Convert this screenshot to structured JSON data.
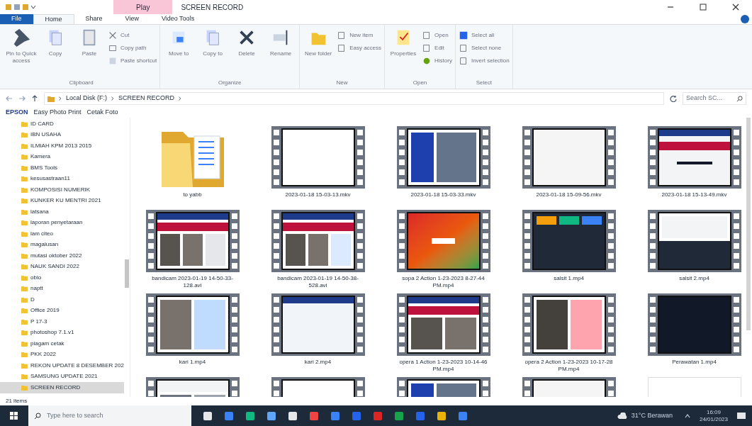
{
  "title_bar": {
    "contextual_tab": "Play",
    "title": "SCREEN RECORD"
  },
  "ribbon_tabs": [
    {
      "label": "File",
      "kind": "file",
      "selected": false
    },
    {
      "label": "Home",
      "kind": "tab",
      "selected": true
    },
    {
      "label": "Share",
      "kind": "tab",
      "selected": false
    },
    {
      "label": "View",
      "kind": "tab",
      "selected": false
    },
    {
      "label": "Video Tools",
      "kind": "tab",
      "selected": false
    }
  ],
  "ribbon_groups": [
    {
      "label": "Clipboard",
      "buttons": [
        {
          "label": "Pin to Quick access",
          "kind": "large"
        },
        {
          "label": "Copy",
          "kind": "large"
        },
        {
          "label": "Paste",
          "kind": "large"
        },
        {
          "label": "Cut",
          "kind": "small"
        },
        {
          "label": "Copy path",
          "kind": "small"
        },
        {
          "label": "Paste shortcut",
          "kind": "small"
        }
      ]
    },
    {
      "label": "Organize",
      "buttons": [
        {
          "label": "Move to",
          "kind": "large"
        },
        {
          "label": "Copy to",
          "kind": "large"
        },
        {
          "label": "Delete",
          "kind": "large"
        },
        {
          "label": "Rename",
          "kind": "large"
        }
      ]
    },
    {
      "label": "New",
      "buttons": [
        {
          "label": "New folder",
          "kind": "large"
        },
        {
          "label": "New item",
          "kind": "small"
        },
        {
          "label": "Easy access",
          "kind": "small"
        }
      ]
    },
    {
      "label": "Open",
      "buttons": [
        {
          "label": "Properties",
          "kind": "large"
        },
        {
          "label": "Open",
          "kind": "small"
        },
        {
          "label": "Edit",
          "kind": "small"
        },
        {
          "label": "History",
          "kind": "small"
        }
      ]
    },
    {
      "label": "Select",
      "buttons": [
        {
          "label": "Select all",
          "kind": "small"
        },
        {
          "label": "Select none",
          "kind": "small"
        },
        {
          "label": "Invert selection",
          "kind": "small"
        }
      ]
    }
  ],
  "address": {
    "path": [
      "Local Disk (F:)",
      "SCREEN RECORD"
    ],
    "search_placeholder": "Search SC..."
  },
  "toolbar": {
    "brand": "EPSON",
    "items": [
      "Easy Photo Print",
      "Cetak Foto"
    ]
  },
  "nav_items": [
    {
      "label": "ID CARD",
      "selected": false
    },
    {
      "label": "IBN USAHA",
      "selected": false
    },
    {
      "label": "ILMIAH KPM 2013 2015",
      "selected": false
    },
    {
      "label": "Kamera",
      "selected": false
    },
    {
      "label": "BMS Tools",
      "selected": false
    },
    {
      "label": "kesusastraan11",
      "selected": false
    },
    {
      "label": "KOMPOSISI NUMERIK",
      "selected": false
    },
    {
      "label": "KUNKER KU MENTRI 2021",
      "selected": false
    },
    {
      "label": "latsana",
      "selected": false
    },
    {
      "label": "laporan penyetaraan",
      "selected": false
    },
    {
      "label": "lam citeo",
      "selected": false
    },
    {
      "label": "magalusan",
      "selected": false
    },
    {
      "label": "mutasi oktober 2022",
      "selected": false
    },
    {
      "label": "NAUK SANDI 2022",
      "selected": false
    },
    {
      "label": "oblo",
      "selected": false
    },
    {
      "label": "naptt",
      "selected": false
    },
    {
      "label": "D",
      "selected": false
    },
    {
      "label": "Office 2019",
      "selected": false
    },
    {
      "label": "P 17-3",
      "selected": false
    },
    {
      "label": "photoshop 7.1.v1",
      "selected": false
    },
    {
      "label": "piagam cetak",
      "selected": false
    },
    {
      "label": "PKK 2022",
      "selected": false
    },
    {
      "label": "REKON UPDATE 8 DESEMBER 202",
      "selected": false
    },
    {
      "label": "SAMSUNG UPDATE 2021",
      "selected": false
    },
    {
      "label": "SCREEN RECORD",
      "selected": true
    }
  ],
  "files": [
    {
      "name": "to yabb",
      "kind": "folder"
    },
    {
      "name": "2023-01-18 15-03-13.mkv",
      "kind": "video"
    },
    {
      "name": "2023-01-18 15-03-33.mkv",
      "kind": "video"
    },
    {
      "name": "2023-01-18 15-09-56.mkv",
      "kind": "video"
    },
    {
      "name": "2023-01-18 15-13-49.mkv",
      "kind": "video"
    },
    {
      "name": "bandicam 2023-01-19 14-50-33-128.avi",
      "kind": "video"
    },
    {
      "name": "bandicam 2023-01-19 14-50-38-528.avi",
      "kind": "video"
    },
    {
      "name": "sopa 2 Action 1-23-2023 8-27-44 PM.mp4",
      "kind": "video"
    },
    {
      "name": "salsit 1.mp4",
      "kind": "video"
    },
    {
      "name": "salsit 2.mp4",
      "kind": "video"
    },
    {
      "name": "kari 1.mp4",
      "kind": "video"
    },
    {
      "name": "kari 2.mp4",
      "kind": "video"
    },
    {
      "name": "opera 1 Action 1-23-2023 10-14-46 PM.mp4",
      "kind": "video"
    },
    {
      "name": "opera 2 Action 1-23-2023 10-17-28 PM.mp4",
      "kind": "video"
    },
    {
      "name": "Perawatan 1.mp4",
      "kind": "video"
    },
    {
      "kind": "video"
    },
    {
      "kind": "video"
    },
    {
      "kind": "video"
    },
    {
      "kind": "video"
    },
    {
      "kind": "image"
    }
  ],
  "status_bar": {
    "count": "21 items"
  },
  "taskbar": {
    "search_placeholder": "Type here to search",
    "weather": "31°C Berawan",
    "time": "16:09",
    "date": "24/01/2023"
  }
}
